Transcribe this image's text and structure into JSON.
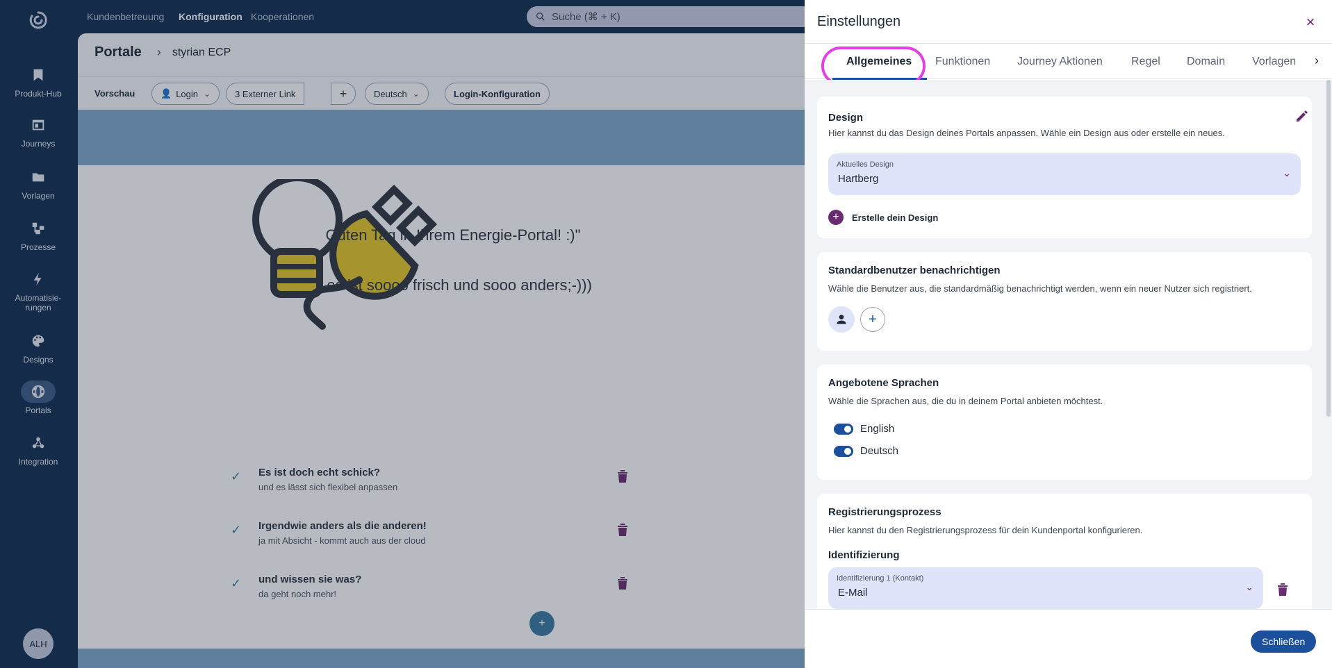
{
  "nav": {
    "logo_icon": "refresh-logo-icon",
    "items": [
      {
        "label": "Produkt-Hub",
        "icon": "bookmark-icon"
      },
      {
        "label": "Journeys",
        "icon": "browser-icon"
      },
      {
        "label": "Vorlagen",
        "icon": "folder-icon"
      },
      {
        "label": "Prozesse",
        "icon": "flow-icon"
      },
      {
        "label": "Automatisie-rungen",
        "icon": "bolt-icon"
      },
      {
        "label": "Designs",
        "icon": "palette-icon"
      },
      {
        "label": "Portals",
        "icon": "globe-icon"
      },
      {
        "label": "Integration",
        "icon": "webhook-icon"
      }
    ],
    "active_item": "Portals",
    "user_initials": "ALH"
  },
  "topbar": {
    "links": [
      "Kundenbetreuung",
      "Konfiguration",
      "Kooperationen"
    ],
    "active_link": "Konfiguration",
    "search_placeholder": "Suche (⌘ + K)"
  },
  "main": {
    "breadcrumb": {
      "root": "Portale",
      "current": "styrian ECP"
    },
    "toolbar": {
      "preview_label": "Vorschau",
      "login_label": "Login",
      "external_links_label": "3 Externer Link",
      "language_label": "Deutsch",
      "login_config_label": "Login-Konfiguration"
    },
    "preview": {
      "greeting": "Guten Tag in Ihrem Energie-Portal! :)\"",
      "subgreeting": "...es ist soooo frisch und sooo anders;-)))",
      "features": [
        {
          "title": "Es ist doch echt schick?",
          "subtitle": "und es lässt sich flexibel anpassen"
        },
        {
          "title": "Irgendwie anders als die anderen!",
          "subtitle": "ja mit Absicht - kommt auch aus der cloud"
        },
        {
          "title": "und wissen sie was?",
          "subtitle": "da geht noch mehr!"
        }
      ],
      "accent_color": "#7ea9cc"
    }
  },
  "panel": {
    "title": "Einstellungen",
    "tabs": [
      "Allgemeines",
      "Funktionen",
      "Journey Aktionen",
      "Regel",
      "Domain",
      "Vorlagen"
    ],
    "active_tab": "Allgemeines",
    "design": {
      "title": "Design",
      "description": "Hier kannst du das Design deines Portals anpassen. Wähle ein Design aus oder erstelle ein neues.",
      "select_label": "Aktuelles Design",
      "select_value": "Hartberg",
      "create_label": "Erstelle dein Design"
    },
    "notify": {
      "title": "Standardbenutzer benachrichtigen",
      "description": "Wähle die Benutzer aus, die standardmäßig benachrichtigt werden, wenn ein neuer Nutzer sich registriert."
    },
    "languages": {
      "title": "Angebotene Sprachen",
      "description": "Wähle die Sprachen aus, die du in deinem Portal anbieten möchtest.",
      "items": [
        {
          "label": "English",
          "enabled": true
        },
        {
          "label": "Deutsch",
          "enabled": true
        }
      ]
    },
    "registration": {
      "title": "Registrierungsprozess",
      "description": "Hier kannst du den Registrierungsprozess für dein Kundenportal konfigurieren.",
      "subtitle": "Identifizierung",
      "select_label": "Identifizierung 1 (Kontakt)",
      "select_value": "E-Mail"
    },
    "close_button": "Schließen",
    "colors": {
      "primary": "#1c4f9c",
      "accent": "#6a2c70",
      "highlight": "#e43fe3"
    }
  }
}
